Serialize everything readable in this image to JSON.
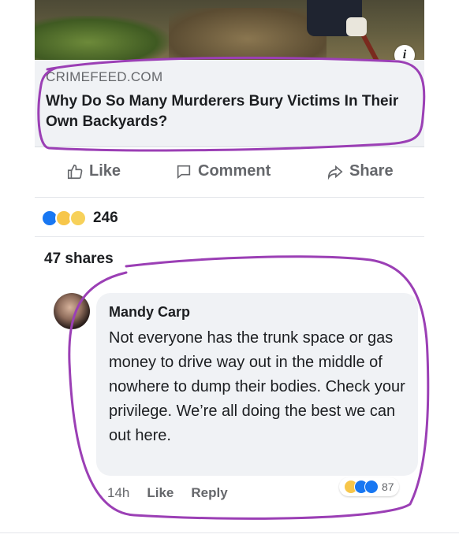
{
  "post": {
    "link_source": "CRIMEFEED.COM",
    "link_title": "Why Do So Many Murderers Bury Victims In Their Own Backyards?",
    "info_glyph": "i"
  },
  "actions": {
    "like_label": "Like",
    "comment_label": "Comment",
    "share_label": "Share"
  },
  "stats": {
    "reaction_icons": [
      "like-icon",
      "wow-icon",
      "sad-icon"
    ],
    "reaction_count": "246",
    "shares_text": "47 shares"
  },
  "comment": {
    "author": "Mandy Carp",
    "text": "Not everyone has the trunk space or gas money to drive way out in the middle of nowhere to dump their bodies. Check your privilege. We’re all doing the best we can out here.",
    "time": "14h",
    "like_label": "Like",
    "reply_label": "Reply",
    "reaction_icons": [
      "haha-icon",
      "like-icon",
      "love-icon"
    ],
    "reaction_count": "87"
  },
  "colors": {
    "accent": "#1877f2",
    "marker": "#9b3fb5",
    "bubble": "#f0f2f5",
    "muted_text": "#65676b"
  }
}
